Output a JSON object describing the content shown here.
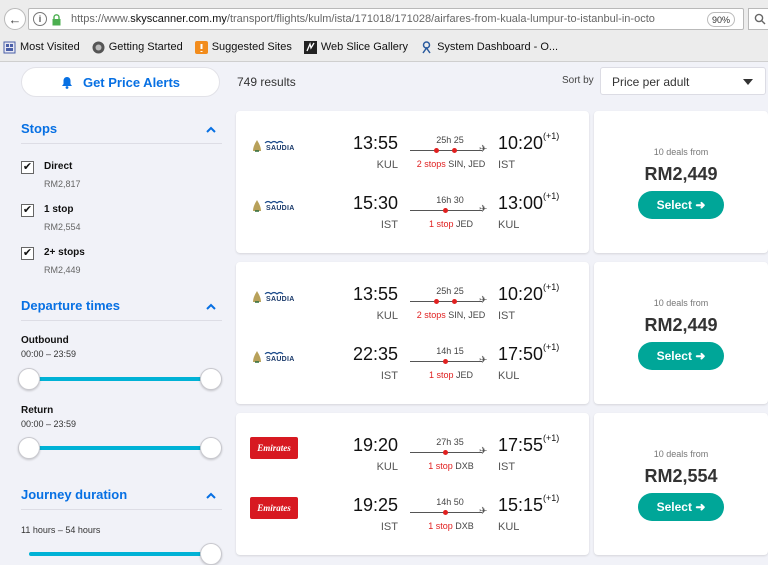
{
  "browser": {
    "url_prefix": "https://www.",
    "url_domain": "skyscanner.com.my",
    "url_path": "/transport/flights/kulm/ista/171018/171028/airfares-from-kuala-lumpur-to-istanbul-in-octo",
    "zoom": "90%"
  },
  "bookmarks": [
    {
      "label": "Most Visited",
      "icon": "bookmarks-icon"
    },
    {
      "label": "Getting Started",
      "icon": "firefox-icon"
    },
    {
      "label": "Suggested Sites",
      "icon": "suggested-sites-icon"
    },
    {
      "label": "Web Slice Gallery",
      "icon": "web-slice-icon"
    },
    {
      "label": "System Dashboard - O...",
      "icon": "dashboard-icon"
    }
  ],
  "header": {
    "alert_label": "Get Price Alerts",
    "results": "749 results",
    "sort_label": "Sort by",
    "sort_value": "Price per adult"
  },
  "filters": {
    "stops_title": "Stops",
    "stops": [
      {
        "label": "Direct",
        "price": "RM2,817",
        "checked": true
      },
      {
        "label": "1 stop",
        "price": "RM2,554",
        "checked": true
      },
      {
        "label": "2+ stops",
        "price": "RM2,449",
        "checked": true
      }
    ],
    "departure_title": "Departure times",
    "outbound_label": "Outbound",
    "outbound_range": "00:00 – 23:59",
    "return_label": "Return",
    "return_range": "00:00 – 23:59",
    "duration_title": "Journey duration",
    "duration_range": "11 hours – 54 hours"
  },
  "results": [
    {
      "legs": [
        {
          "airline": "SAUDIA",
          "dep": "13:55",
          "dep_code": "KUL",
          "duration": "25h 25",
          "stops_count": "2 stops",
          "stops_via": "SIN, JED",
          "arr": "10:20",
          "arr_offset": "(+1)",
          "arr_code": "IST"
        },
        {
          "airline": "SAUDIA",
          "dep": "15:30",
          "dep_code": "IST",
          "duration": "16h 30",
          "stops_count": "1 stop",
          "stops_via": "JED",
          "arr": "13:00",
          "arr_offset": "(+1)",
          "arr_code": "KUL"
        }
      ],
      "deals": "10 deals from",
      "price": "RM2,449",
      "select": "Select"
    },
    {
      "legs": [
        {
          "airline": "SAUDIA",
          "dep": "13:55",
          "dep_code": "KUL",
          "duration": "25h 25",
          "stops_count": "2 stops",
          "stops_via": "SIN, JED",
          "arr": "10:20",
          "arr_offset": "(+1)",
          "arr_code": "IST"
        },
        {
          "airline": "SAUDIA",
          "dep": "22:35",
          "dep_code": "IST",
          "duration": "14h 15",
          "stops_count": "1 stop",
          "stops_via": "JED",
          "arr": "17:50",
          "arr_offset": "(+1)",
          "arr_code": "KUL"
        }
      ],
      "deals": "10 deals from",
      "price": "RM2,449",
      "select": "Select"
    },
    {
      "legs": [
        {
          "airline": "Emirates",
          "dep": "19:20",
          "dep_code": "KUL",
          "duration": "27h 35",
          "stops_count": "1 stop",
          "stops_via": "DXB",
          "arr": "17:55",
          "arr_offset": "(+1)",
          "arr_code": "IST"
        },
        {
          "airline": "Emirates",
          "dep": "19:25",
          "dep_code": "IST",
          "duration": "14h 50",
          "stops_count": "1 stop",
          "stops_via": "DXB",
          "arr": "15:15",
          "arr_offset": "(+1)",
          "arr_code": "KUL"
        }
      ],
      "deals": "10 deals from",
      "price": "RM2,554",
      "select": "Select"
    }
  ],
  "colors": {
    "accent": "#0770e3",
    "select": "#00a698",
    "slider": "#00b2d6",
    "stop_red": "#e02020",
    "emirates": "#d71921"
  }
}
